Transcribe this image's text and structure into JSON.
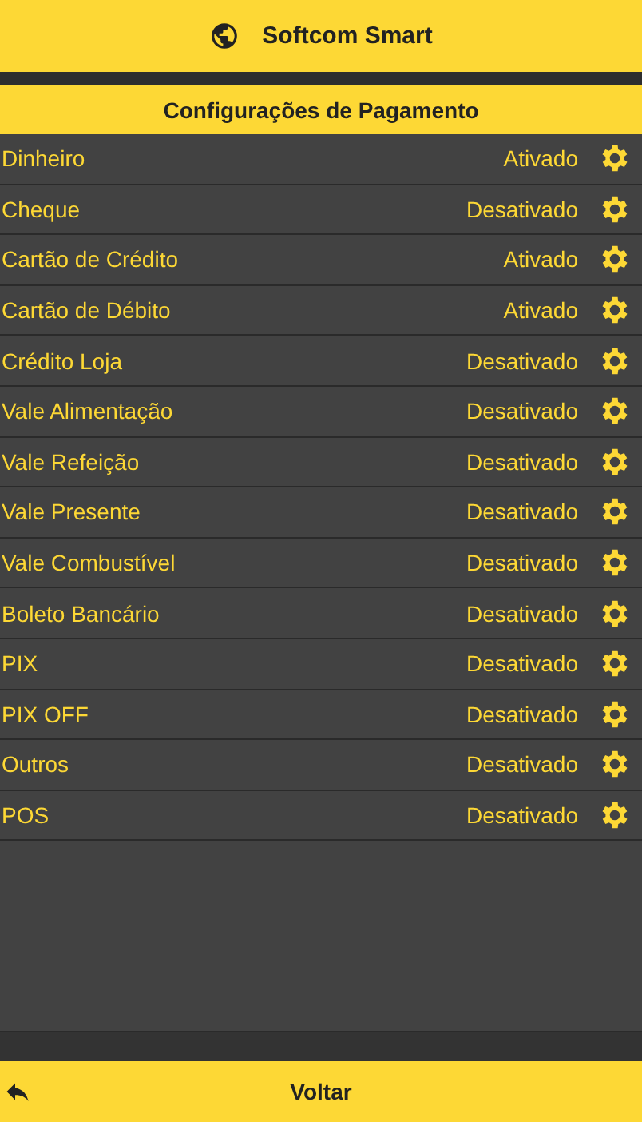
{
  "header": {
    "title": "Softcom Smart"
  },
  "section_title": "Configurações de Pagamento",
  "payment_methods": [
    {
      "name": "Dinheiro",
      "status": "Ativado"
    },
    {
      "name": "Cheque",
      "status": "Desativado"
    },
    {
      "name": "Cartão de Crédito",
      "status": "Ativado"
    },
    {
      "name": "Cartão de Débito",
      "status": "Ativado"
    },
    {
      "name": "Crédito Loja",
      "status": "Desativado"
    },
    {
      "name": "Vale Alimentação",
      "status": "Desativado"
    },
    {
      "name": "Vale Refeição",
      "status": "Desativado"
    },
    {
      "name": "Vale Presente",
      "status": "Desativado"
    },
    {
      "name": "Vale Combustível",
      "status": "Desativado"
    },
    {
      "name": "Boleto Bancário",
      "status": "Desativado"
    },
    {
      "name": "PIX",
      "status": "Desativado"
    },
    {
      "name": "PIX OFF",
      "status": "Desativado"
    },
    {
      "name": "Outros",
      "status": "Desativado"
    },
    {
      "name": "POS",
      "status": "Desativado"
    }
  ],
  "footer": {
    "back_label": "Voltar"
  }
}
